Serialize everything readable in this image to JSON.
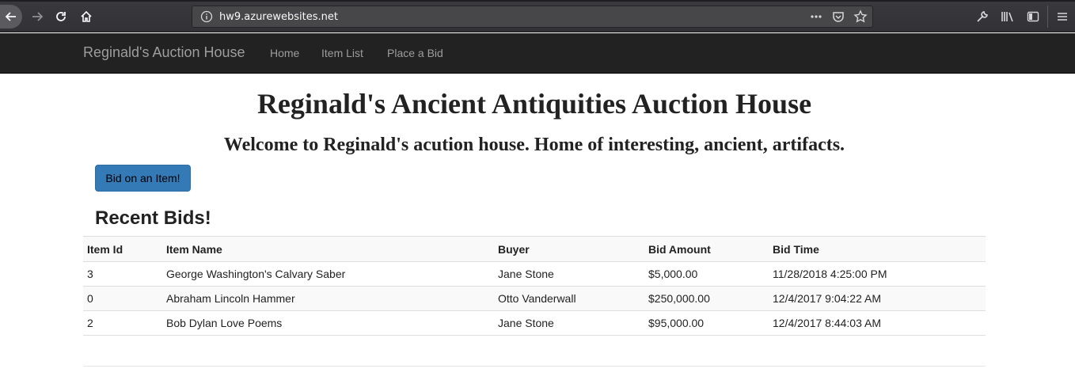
{
  "browser": {
    "url": "hw9.azurewebsites.net",
    "icons": [
      "back-arrow-icon",
      "forward-arrow-icon",
      "reload-icon",
      "home-icon",
      "info-icon",
      "more-icon",
      "pocket-icon",
      "bookmark-star-icon",
      "wrench-icon",
      "library-icon",
      "sidebar-icon",
      "menu-icon"
    ]
  },
  "navbar": {
    "brand": "Reginald's Auction House",
    "links": [
      "Home",
      "Item List",
      "Place a Bid"
    ]
  },
  "main": {
    "title": "Reginald's Ancient Antiquities Auction House",
    "subtitle": "Welcome to Reginald's acution house. Home of interesting, ancient, artifacts.",
    "bid_button": "Bid on an Item!",
    "section_title": "Recent Bids!",
    "table": {
      "headers": [
        "Item Id",
        "Item Name",
        "Buyer",
        "Bid Amount",
        "Bid Time"
      ],
      "rows": [
        [
          "3",
          "George Washington's Calvary Saber",
          "Jane Stone",
          "$5,000.00",
          "11/28/2018 4:25:00 PM"
        ],
        [
          "0",
          "Abraham Lincoln Hammer",
          "Otto Vanderwall",
          "$250,000.00",
          "12/4/2017 9:04:22 AM"
        ],
        [
          "2",
          "Bob Dylan Love Poems",
          "Jane Stone",
          "$95,000.00",
          "12/4/2017 8:44:03 AM"
        ]
      ]
    }
  },
  "colors": {
    "navbar_bg": "#222222",
    "navbar_text": "#9d9d9d",
    "primary_button": "#337ab7",
    "browser_chrome": "#38383d"
  }
}
